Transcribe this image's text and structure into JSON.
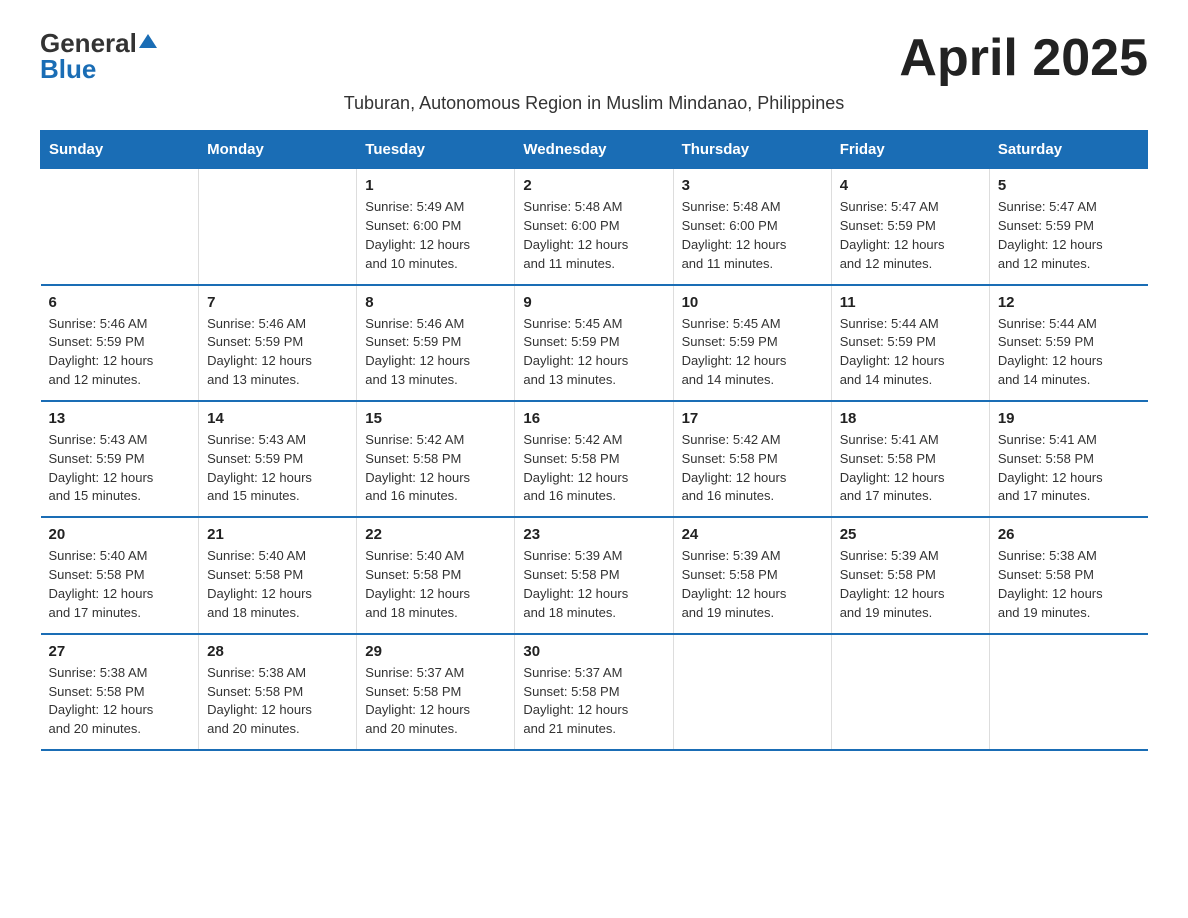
{
  "logo": {
    "general": "General",
    "blue": "Blue"
  },
  "title": "April 2025",
  "subtitle": "Tuburan, Autonomous Region in Muslim Mindanao, Philippines",
  "header": {
    "colors": {
      "bg": "#1a6db5"
    }
  },
  "weekdays": [
    "Sunday",
    "Monday",
    "Tuesday",
    "Wednesday",
    "Thursday",
    "Friday",
    "Saturday"
  ],
  "weeks": [
    [
      {
        "day": "",
        "info": ""
      },
      {
        "day": "",
        "info": ""
      },
      {
        "day": "1",
        "info": "Sunrise: 5:49 AM\nSunset: 6:00 PM\nDaylight: 12 hours\nand 10 minutes."
      },
      {
        "day": "2",
        "info": "Sunrise: 5:48 AM\nSunset: 6:00 PM\nDaylight: 12 hours\nand 11 minutes."
      },
      {
        "day": "3",
        "info": "Sunrise: 5:48 AM\nSunset: 6:00 PM\nDaylight: 12 hours\nand 11 minutes."
      },
      {
        "day": "4",
        "info": "Sunrise: 5:47 AM\nSunset: 5:59 PM\nDaylight: 12 hours\nand 12 minutes."
      },
      {
        "day": "5",
        "info": "Sunrise: 5:47 AM\nSunset: 5:59 PM\nDaylight: 12 hours\nand 12 minutes."
      }
    ],
    [
      {
        "day": "6",
        "info": "Sunrise: 5:46 AM\nSunset: 5:59 PM\nDaylight: 12 hours\nand 12 minutes."
      },
      {
        "day": "7",
        "info": "Sunrise: 5:46 AM\nSunset: 5:59 PM\nDaylight: 12 hours\nand 13 minutes."
      },
      {
        "day": "8",
        "info": "Sunrise: 5:46 AM\nSunset: 5:59 PM\nDaylight: 12 hours\nand 13 minutes."
      },
      {
        "day": "9",
        "info": "Sunrise: 5:45 AM\nSunset: 5:59 PM\nDaylight: 12 hours\nand 13 minutes."
      },
      {
        "day": "10",
        "info": "Sunrise: 5:45 AM\nSunset: 5:59 PM\nDaylight: 12 hours\nand 14 minutes."
      },
      {
        "day": "11",
        "info": "Sunrise: 5:44 AM\nSunset: 5:59 PM\nDaylight: 12 hours\nand 14 minutes."
      },
      {
        "day": "12",
        "info": "Sunrise: 5:44 AM\nSunset: 5:59 PM\nDaylight: 12 hours\nand 14 minutes."
      }
    ],
    [
      {
        "day": "13",
        "info": "Sunrise: 5:43 AM\nSunset: 5:59 PM\nDaylight: 12 hours\nand 15 minutes."
      },
      {
        "day": "14",
        "info": "Sunrise: 5:43 AM\nSunset: 5:59 PM\nDaylight: 12 hours\nand 15 minutes."
      },
      {
        "day": "15",
        "info": "Sunrise: 5:42 AM\nSunset: 5:58 PM\nDaylight: 12 hours\nand 16 minutes."
      },
      {
        "day": "16",
        "info": "Sunrise: 5:42 AM\nSunset: 5:58 PM\nDaylight: 12 hours\nand 16 minutes."
      },
      {
        "day": "17",
        "info": "Sunrise: 5:42 AM\nSunset: 5:58 PM\nDaylight: 12 hours\nand 16 minutes."
      },
      {
        "day": "18",
        "info": "Sunrise: 5:41 AM\nSunset: 5:58 PM\nDaylight: 12 hours\nand 17 minutes."
      },
      {
        "day": "19",
        "info": "Sunrise: 5:41 AM\nSunset: 5:58 PM\nDaylight: 12 hours\nand 17 minutes."
      }
    ],
    [
      {
        "day": "20",
        "info": "Sunrise: 5:40 AM\nSunset: 5:58 PM\nDaylight: 12 hours\nand 17 minutes."
      },
      {
        "day": "21",
        "info": "Sunrise: 5:40 AM\nSunset: 5:58 PM\nDaylight: 12 hours\nand 18 minutes."
      },
      {
        "day": "22",
        "info": "Sunrise: 5:40 AM\nSunset: 5:58 PM\nDaylight: 12 hours\nand 18 minutes."
      },
      {
        "day": "23",
        "info": "Sunrise: 5:39 AM\nSunset: 5:58 PM\nDaylight: 12 hours\nand 18 minutes."
      },
      {
        "day": "24",
        "info": "Sunrise: 5:39 AM\nSunset: 5:58 PM\nDaylight: 12 hours\nand 19 minutes."
      },
      {
        "day": "25",
        "info": "Sunrise: 5:39 AM\nSunset: 5:58 PM\nDaylight: 12 hours\nand 19 minutes."
      },
      {
        "day": "26",
        "info": "Sunrise: 5:38 AM\nSunset: 5:58 PM\nDaylight: 12 hours\nand 19 minutes."
      }
    ],
    [
      {
        "day": "27",
        "info": "Sunrise: 5:38 AM\nSunset: 5:58 PM\nDaylight: 12 hours\nand 20 minutes."
      },
      {
        "day": "28",
        "info": "Sunrise: 5:38 AM\nSunset: 5:58 PM\nDaylight: 12 hours\nand 20 minutes."
      },
      {
        "day": "29",
        "info": "Sunrise: 5:37 AM\nSunset: 5:58 PM\nDaylight: 12 hours\nand 20 minutes."
      },
      {
        "day": "30",
        "info": "Sunrise: 5:37 AM\nSunset: 5:58 PM\nDaylight: 12 hours\nand 21 minutes."
      },
      {
        "day": "",
        "info": ""
      },
      {
        "day": "",
        "info": ""
      },
      {
        "day": "",
        "info": ""
      }
    ]
  ]
}
